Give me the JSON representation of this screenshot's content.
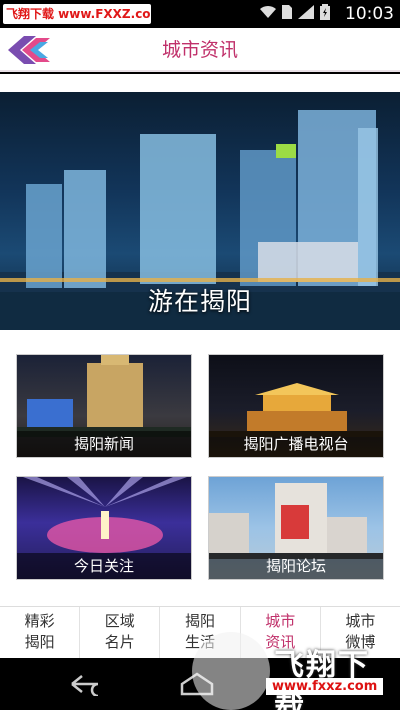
{
  "status_bar": {
    "watermark_text": "飞翔下载 www.FXXZ.com",
    "time": "10:03",
    "icons": [
      "wifi-icon",
      "sim-card-icon",
      "signal-3g-icon",
      "battery-charging-icon"
    ]
  },
  "header": {
    "title": "城市资讯",
    "logo": "app-logo-icon"
  },
  "banner": {
    "caption": "游在揭阳"
  },
  "tiles": [
    {
      "label": "揭阳新闻"
    },
    {
      "label": "揭阳广播电视台"
    },
    {
      "label": "今日关注"
    },
    {
      "label": "揭阳论坛"
    }
  ],
  "bottom_tabs": [
    {
      "line1": "精彩",
      "line2": "揭阳"
    },
    {
      "line1": "区域",
      "line2": "名片"
    },
    {
      "line1": "揭阳",
      "line2": "生活"
    },
    {
      "line1": "城市",
      "line2": "资讯"
    },
    {
      "line1": "城市",
      "line2": "微博"
    }
  ],
  "active_tab": "城市资讯",
  "watermark": {
    "big_text": "飞翔下载",
    "url": "www.fxxz.com"
  },
  "colors": {
    "accent": "#c0306a",
    "header_bg": "#ffffff",
    "status_bar_bg": "#000000"
  }
}
